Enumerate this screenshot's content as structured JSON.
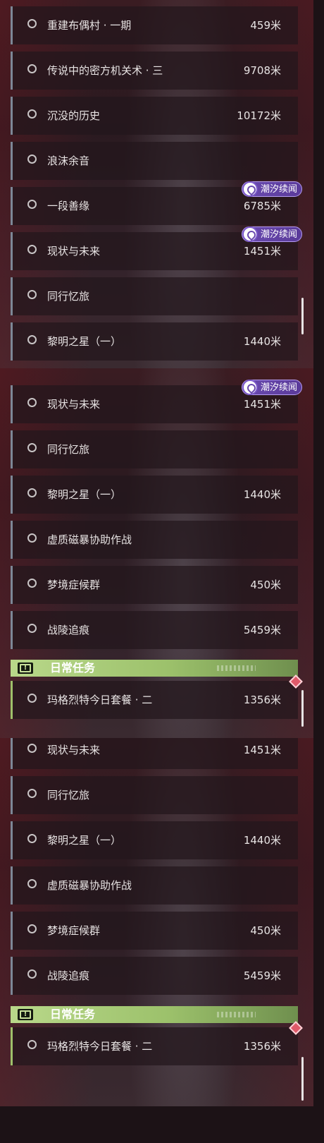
{
  "panels": [
    {
      "rows": [
        {
          "name": "重建布偶村 · 一期",
          "distance": "459米"
        },
        {
          "name": "传说中的密方机关术 · 三",
          "distance": "9708米"
        },
        {
          "name": "沉没的历史",
          "distance": "10172米"
        },
        {
          "name": "浪沫余音",
          "distance": ""
        },
        {
          "name": "一段善缘",
          "distance": "6785米",
          "badge": "潮汐续闻"
        },
        {
          "name": "现状与未来",
          "distance": "1451米",
          "badge": "潮汐续闻"
        },
        {
          "name": "同行忆旅",
          "distance": ""
        },
        {
          "name": "黎明之星（一）",
          "distance": "1440米"
        }
      ]
    },
    {
      "rows": [
        {
          "name": "现状与未来",
          "distance": "1451米",
          "badge": "潮汐续闻"
        },
        {
          "name": "同行忆旅",
          "distance": ""
        },
        {
          "name": "黎明之星（一）",
          "distance": "1440米"
        },
        {
          "name": "虚质磁暴协助作战",
          "distance": ""
        },
        {
          "name": "梦境症候群",
          "distance": "450米"
        },
        {
          "name": "战陵追痕",
          "distance": "5459米"
        }
      ],
      "daily_header": "日常任务",
      "daily_rows": [
        {
          "name": "玛格烈特今日套餐 · 二",
          "distance": "1356米"
        }
      ]
    },
    {
      "rows": [
        {
          "name": "现状与未来",
          "distance": "1451米"
        },
        {
          "name": "同行忆旅",
          "distance": ""
        },
        {
          "name": "黎明之星（一）",
          "distance": "1440米"
        },
        {
          "name": "虚质磁暴协助作战",
          "distance": ""
        },
        {
          "name": "梦境症候群",
          "distance": "450米"
        },
        {
          "name": "战陵追痕",
          "distance": "5459米"
        }
      ],
      "daily_header": "日常任务",
      "daily_rows": [
        {
          "name": "玛格烈特今日套餐 · 二",
          "distance": "1356米"
        }
      ]
    }
  ],
  "colors": {
    "badge": "#6a4bb0",
    "daily_header": "#9cc16b",
    "row_accent": "#7d8796",
    "daily_accent": "#9fc06a",
    "marker": "#e05a6a"
  },
  "icons": {
    "row": "radio-circle-icon",
    "badge": "tidal-feather-icon",
    "daily_header": "exclamation-box-icon",
    "daily_row_marker": "diamond-marker-icon"
  }
}
